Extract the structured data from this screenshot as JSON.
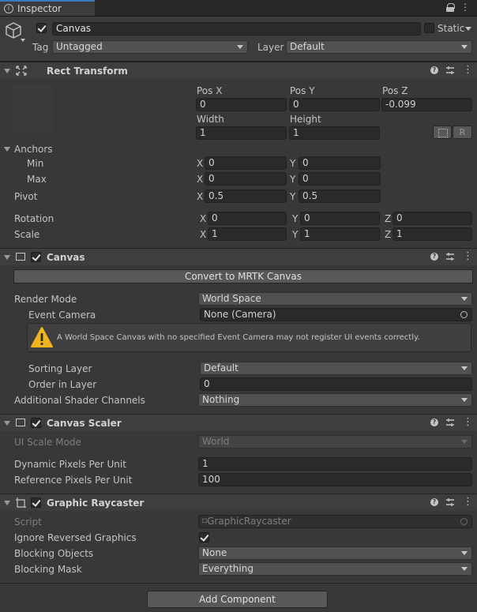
{
  "tab": {
    "title": "Inspector"
  },
  "gameobject": {
    "name": "Canvas",
    "static_label": "Static",
    "tag_label": "Tag",
    "tag_value": "Untagged",
    "layer_label": "Layer",
    "layer_value": "Default"
  },
  "rect_transform": {
    "title": "Rect Transform",
    "pos_x_label": "Pos X",
    "pos_y_label": "Pos Y",
    "pos_z_label": "Pos Z",
    "pos_x": "0",
    "pos_y": "0",
    "pos_z": "-0.099",
    "width_label": "Width",
    "height_label": "Height",
    "width": "1",
    "height": "1",
    "r_label": "R",
    "anchors_label": "Anchors",
    "min_label": "Min",
    "min_x": "0",
    "min_y": "0",
    "max_label": "Max",
    "max_x": "0",
    "max_y": "0",
    "pivot_label": "Pivot",
    "pivot_x": "0.5",
    "pivot_y": "0.5",
    "rotation_label": "Rotation",
    "rot_x": "0",
    "rot_y": "0",
    "rot_z": "0",
    "scale_label": "Scale",
    "scale_x": "1",
    "scale_y": "1",
    "scale_z": "1",
    "x": "X",
    "y": "Y",
    "z": "Z"
  },
  "canvas": {
    "title": "Canvas",
    "convert_button": "Convert to MRTK Canvas",
    "render_mode_label": "Render Mode",
    "render_mode": "World Space",
    "event_camera_label": "Event Camera",
    "event_camera": "None (Camera)",
    "warning": "A World Space Canvas with no specified Event Camera may not register UI events correctly.",
    "sorting_layer_label": "Sorting Layer",
    "sorting_layer": "Default",
    "order_label": "Order in Layer",
    "order": "0",
    "shader_channels_label": "Additional Shader Channels",
    "shader_channels": "Nothing"
  },
  "canvas_scaler": {
    "title": "Canvas Scaler",
    "ui_scale_mode_label": "UI Scale Mode",
    "ui_scale_mode": "World",
    "dynamic_ppu_label": "Dynamic Pixels Per Unit",
    "dynamic_ppu": "1",
    "reference_ppu_label": "Reference Pixels Per Unit",
    "reference_ppu": "100"
  },
  "graphic_raycaster": {
    "title": "Graphic Raycaster",
    "script_label": "Script",
    "script": "GraphicRaycaster",
    "ignore_reversed_label": "Ignore Reversed Graphics",
    "blocking_objects_label": "Blocking Objects",
    "blocking_objects": "None",
    "blocking_mask_label": "Blocking Mask",
    "blocking_mask": "Everything"
  },
  "add_component": "Add Component",
  "colors": {
    "background": "#383838",
    "field": "#2a2a2a",
    "header": "#3e3e3e",
    "warning": "#f0b41e"
  }
}
